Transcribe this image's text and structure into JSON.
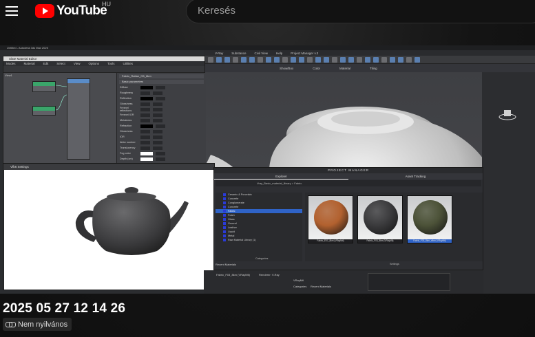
{
  "header": {
    "logo_text": "YouTube",
    "region": "HU",
    "search_placeholder": "Keresés"
  },
  "video": {
    "max_title": "Untitled - Autodesk 3ds Max 2025",
    "max_menu": [
      "Views",
      "Material",
      "Edit",
      "Select",
      "View",
      "Options",
      "Tools",
      "Utilities",
      "V-Ray",
      "Substance",
      "Civil View",
      "Help",
      "Project Manager v.3"
    ],
    "max_toolbar2": [
      "Show/Box",
      "Color",
      "Material",
      "Tiling"
    ],
    "slate_title": "Slate Material Editor",
    "slate_menu": [
      "Modes",
      "Material",
      "Edit",
      "Select",
      "View",
      "Options",
      "Tools",
      "Utilities"
    ],
    "slate_view_label": "View1",
    "params_header": "Fabric_Rattan_09\\_8km",
    "param_sections": [
      "Basic parameters"
    ],
    "params": [
      {
        "label": "Diffuse",
        "swatch": "black"
      },
      {
        "label": "Roughness",
        "swatch": "none"
      },
      {
        "label": "Reflection",
        "swatch": "black"
      },
      {
        "label": "Glossiness",
        "swatch": "none"
      },
      {
        "label": "Fresnel reflections",
        "swatch": "none"
      },
      {
        "label": "Fresnel IOR",
        "swatch": "none"
      },
      {
        "label": "Metalness",
        "swatch": "none"
      },
      {
        "label": "Refraction",
        "swatch": "black"
      },
      {
        "label": "Glossiness",
        "swatch": "none"
      },
      {
        "label": "IOR",
        "swatch": "none"
      },
      {
        "label": "Abbe number",
        "swatch": "none"
      },
      {
        "label": "Translucency",
        "swatch": "none"
      },
      {
        "label": "Fog color",
        "swatch": "white"
      },
      {
        "label": "Depth (cm)",
        "swatch": "white"
      }
    ],
    "vfb_title": "Vfb6 Settings",
    "pm": {
      "title": "PROJECT MANAGER",
      "tabs": [
        "Explorer",
        "Asset Tracking"
      ],
      "path": "Vray_Basic_material_library  >  Fabric",
      "tree": [
        "Ceramic & Porcelain",
        "Concrete",
        "Conglomerate",
        "Concrete",
        "Fabric",
        "Foam",
        "Glass",
        "Ground",
        "Leather",
        "Liquid",
        "Metal",
        "Raw Material Library (1)"
      ],
      "tree_selected_index": 4,
      "recent_label": "Recent Materials",
      "categories_label": "Categories",
      "settings_label": "Settings",
      "thumbs": [
        {
          "caption": "Fabric_E01_8km (VRayMtl)",
          "color": "#b2612f",
          "selected": false
        },
        {
          "caption": "Fabric_F03_8km (VRayMtl)",
          "color": "#3b3b3d",
          "selected": false
        },
        {
          "caption": "Fabric_F03_8km_xfbm (VRayMtl)",
          "color": "#4c5238",
          "selected": true
        }
      ]
    },
    "bottom": {
      "label1": "Fabric_F03_8km (VRayMtl)",
      "label2": "Renderer: V-Ray",
      "label3": "VRayMtl",
      "label4": "Categories",
      "label5": "Recent Materials"
    }
  },
  "title": "2025 05 27 12 14 26",
  "visibility": "Nem nyilvános"
}
